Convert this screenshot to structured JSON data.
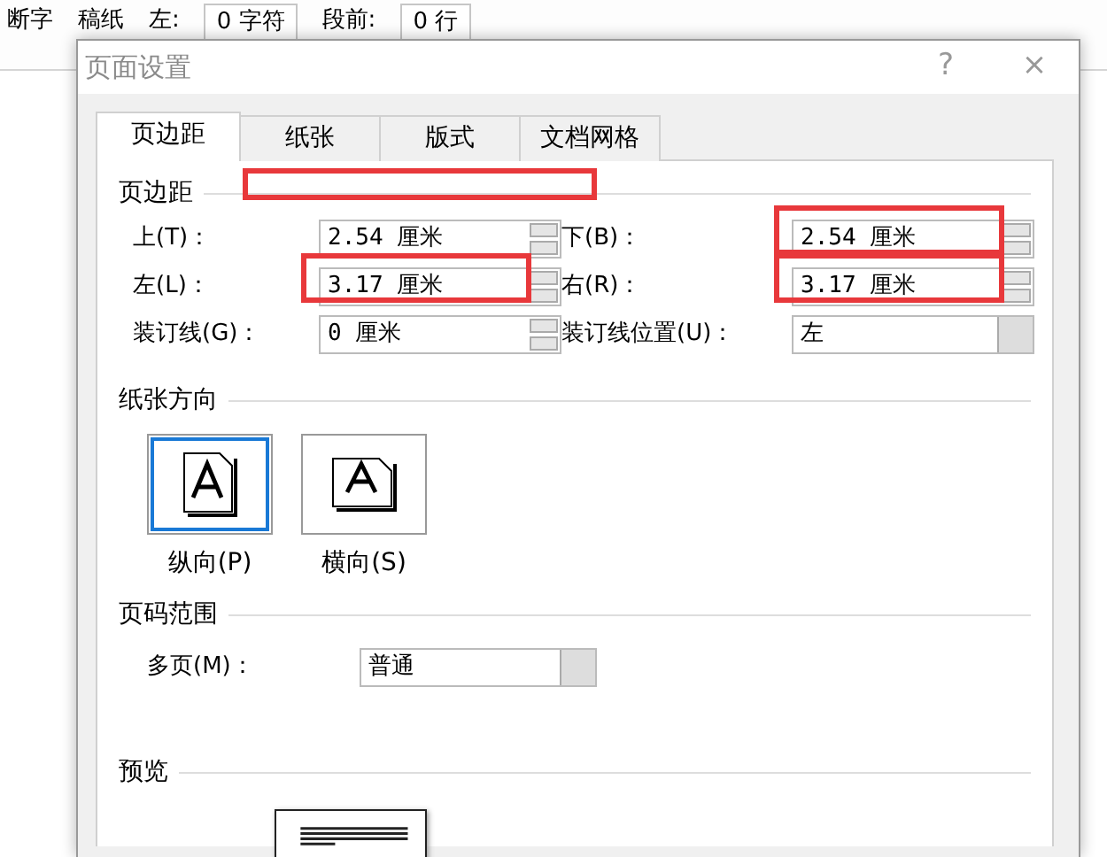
{
  "ribbon": {
    "items": [
      "断字",
      "稿纸",
      "左:",
      "0 字符",
      "段前:",
      "0 行"
    ]
  },
  "dialog": {
    "title": "页面设置",
    "help": "?",
    "close": "×",
    "tabs": [
      {
        "label": "页边距",
        "selected": true
      },
      {
        "label": "纸张",
        "selected": false
      },
      {
        "label": "版式",
        "selected": false
      },
      {
        "label": "文档网格",
        "selected": false
      }
    ],
    "margins": {
      "heading": "页边距",
      "highlighted": true,
      "fields": [
        {
          "kind": "spin",
          "label": "上(T)：",
          "value": "2.54 厘米",
          "highlighted": false
        },
        {
          "kind": "spin",
          "label": "下(B)：",
          "value": "2.54 厘米",
          "highlighted": true
        },
        {
          "kind": "spin",
          "label": "左(L)：",
          "value": "3.17 厘米",
          "highlighted": true
        },
        {
          "kind": "spin",
          "label": "右(R)：",
          "value": "3.17 厘米",
          "highlighted": true
        },
        {
          "kind": "spin",
          "label": "装订线(G)：",
          "value": "0 厘米",
          "highlighted": false
        },
        {
          "kind": "select",
          "label": "装订线位置(U)：",
          "value": "左",
          "highlighted": false
        }
      ]
    },
    "orientation": {
      "heading": "纸张方向",
      "options": [
        {
          "kind": "portrait",
          "label": "纵向(P)",
          "selected": true
        },
        {
          "kind": "landscape",
          "label": "横向(S)",
          "selected": false
        }
      ]
    },
    "pages": {
      "heading": "页码范围",
      "label": "多页(M)：",
      "value": "普通"
    },
    "preview": {
      "heading": "预览"
    }
  }
}
